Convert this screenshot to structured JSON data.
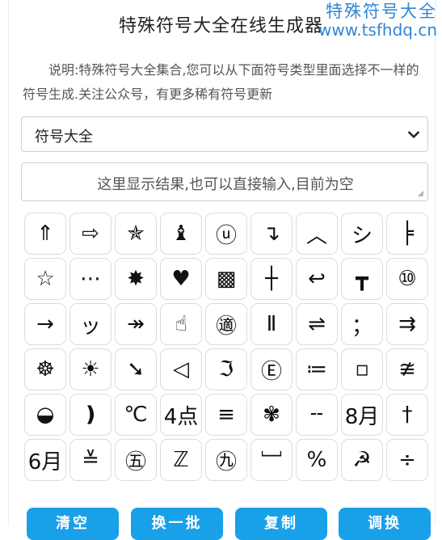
{
  "header": {
    "title": "特殊符号大全在线生成器",
    "watermark_line1": "特殊符号大全",
    "watermark_line2": "www.tsfhdq.cn"
  },
  "description": "说明:特殊符号大全集合,您可以从下面符号类型里面选择不一样的符号生成.关注公众号，有更多稀有符号更新",
  "category_select": {
    "selected": "符号大全"
  },
  "output": {
    "placeholder": "这里显示结果,也可以直接输入,目前为空"
  },
  "symbols": [
    "⇑",
    "⇨",
    "✯",
    "♝",
    "ⓤ",
    "↴",
    "︿",
    "シ",
    "╞",
    "☆",
    "⋯",
    "✸",
    "♥",
    "▩",
    "┼",
    "↩",
    "┳",
    "⑩",
    "→",
    "ッ",
    "↠",
    "☝",
    "㊜",
    "Ⅱ",
    "⇌",
    "；",
    "⇉",
    "☸",
    "☀",
    "➘",
    "◁",
    "ℑ",
    "Ⓔ",
    "≔",
    "▫",
    "≇",
    "◒",
    "❫",
    "℃",
    "4点",
    "≡",
    "✾",
    "╌",
    "8月",
    "†",
    "6月",
    "≚",
    "㊄",
    "ℤ",
    "㊈",
    "﹈",
    "%",
    "☭",
    "÷"
  ],
  "buttons": {
    "clear": "清空",
    "change": "换一批",
    "copy": "复制",
    "more": "调换"
  },
  "colors": {
    "accent": "#18a0e8",
    "watermark": "#2f86d6"
  }
}
